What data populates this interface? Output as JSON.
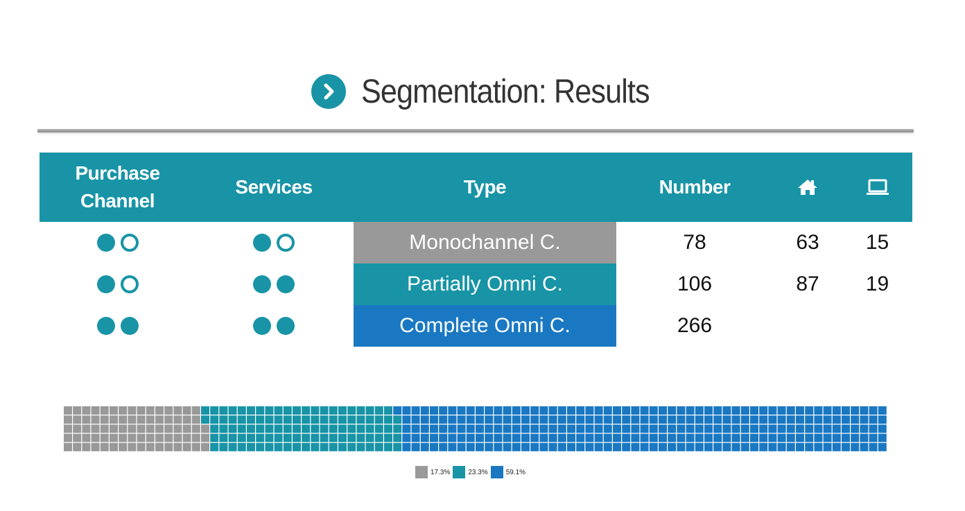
{
  "title": "Segmentation: Results",
  "colors": {
    "accent": "#1894a6",
    "gray": "#999999",
    "teal": "#1894a6",
    "blue": "#1a78c2"
  },
  "header": {
    "purchase_channel": "Purchase Channel",
    "services": "Services",
    "type": "Type",
    "number": "Number",
    "home_icon": "home-icon",
    "laptop_icon": "laptop-icon"
  },
  "rows": [
    {
      "purchase": [
        "full",
        "empty"
      ],
      "services": [
        "full",
        "empty"
      ],
      "type": "Monochannel C.",
      "type_color": "#999999",
      "number": "78",
      "home": "63",
      "online": "15"
    },
    {
      "purchase": [
        "full",
        "empty"
      ],
      "services": [
        "full",
        "full"
      ],
      "type": "Partially Omni C.",
      "type_color": "#1894a6",
      "number": "106",
      "home": "87",
      "online": "19"
    },
    {
      "purchase": [
        "full",
        "full"
      ],
      "services": [
        "full",
        "full"
      ],
      "type": "Complete Omni C.",
      "type_color": "#1a78c2",
      "number": "266",
      "home": "",
      "online": ""
    }
  ],
  "chart_data": {
    "type": "waffle",
    "series": [
      {
        "value": 17.3,
        "color": "#999999"
      },
      {
        "value": 23.3,
        "color": "#1894a6"
      },
      {
        "value": 59.1,
        "color": "#1a78c2"
      }
    ],
    "counts": [
      78,
      106,
      266
    ],
    "legend": [
      "17.3%",
      "23.3%",
      "59.1%"
    ]
  }
}
